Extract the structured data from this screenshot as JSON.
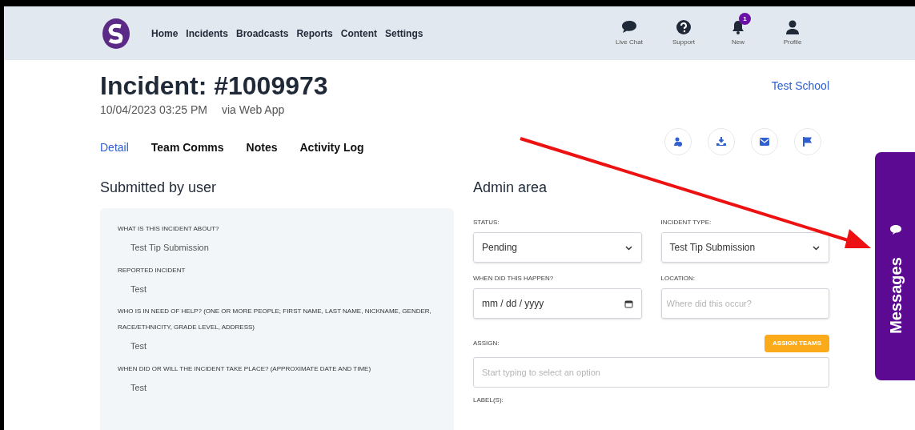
{
  "nav": {
    "items": [
      {
        "label": "Home"
      },
      {
        "label": "Incidents"
      },
      {
        "label": "Broadcasts"
      },
      {
        "label": "Reports"
      },
      {
        "label": "Content"
      },
      {
        "label": "Settings"
      }
    ],
    "actions": [
      {
        "kind": "chat",
        "label": "Live Chat"
      },
      {
        "kind": "help",
        "label": "Support"
      },
      {
        "kind": "bell",
        "label": "New",
        "badge": "1"
      },
      {
        "kind": "user",
        "label": "Profile"
      }
    ]
  },
  "incident": {
    "title": "Incident: #1009973",
    "datetime": "10/04/2023 03:25 PM",
    "source": "via Web App",
    "school": "Test School"
  },
  "tabs": [
    {
      "label": "Detail",
      "selected": true
    },
    {
      "label": "Team Comms",
      "selected": false
    },
    {
      "label": "Notes",
      "selected": false
    },
    {
      "label": "Activity Log",
      "selected": false
    }
  ],
  "toolbar": [
    {
      "kind": "people"
    },
    {
      "kind": "download"
    },
    {
      "kind": "mail"
    },
    {
      "kind": "flag"
    }
  ],
  "submitted": {
    "title": "Submitted by user",
    "items": [
      {
        "question": "WHAT IS THIS INCIDENT ABOUT?",
        "answer": "Test Tip Submission"
      },
      {
        "question": "REPORTED INCIDENT",
        "answer": "Test"
      },
      {
        "question": "WHO IS IN NEED OF HELP? (ONE OR MORE PEOPLE; FIRST NAME, LAST NAME, NICKNAME, GENDER, RACE/ETHNICITY, GRADE LEVEL, ADDRESS)",
        "answer": "Test"
      },
      {
        "question": "WHEN DID OR WILL THE INCIDENT TAKE PLACE? (APPROXIMATE DATE AND TIME)",
        "answer": "Test"
      }
    ]
  },
  "admin": {
    "title": "Admin area",
    "fields": [
      {
        "kind": "select",
        "label": "STATUS:",
        "value": "Pending"
      },
      {
        "kind": "select",
        "label": "INCIDENT TYPE:",
        "value": "Test Tip Submission"
      },
      {
        "kind": "date",
        "label": "WHEN DID THIS HAPPEN?",
        "value": "mm / dd / yyyy"
      },
      {
        "kind": "text",
        "label": "LOCATION:",
        "placeholder": "Where did this occur?"
      }
    ],
    "assign": {
      "label": "ASSIGN:",
      "button": "ASSIGN TEAMS",
      "placeholder": "Start typing to select an option"
    },
    "labels_label": "LABEL(S):"
  },
  "messages_tab": {
    "label": "Messages"
  }
}
